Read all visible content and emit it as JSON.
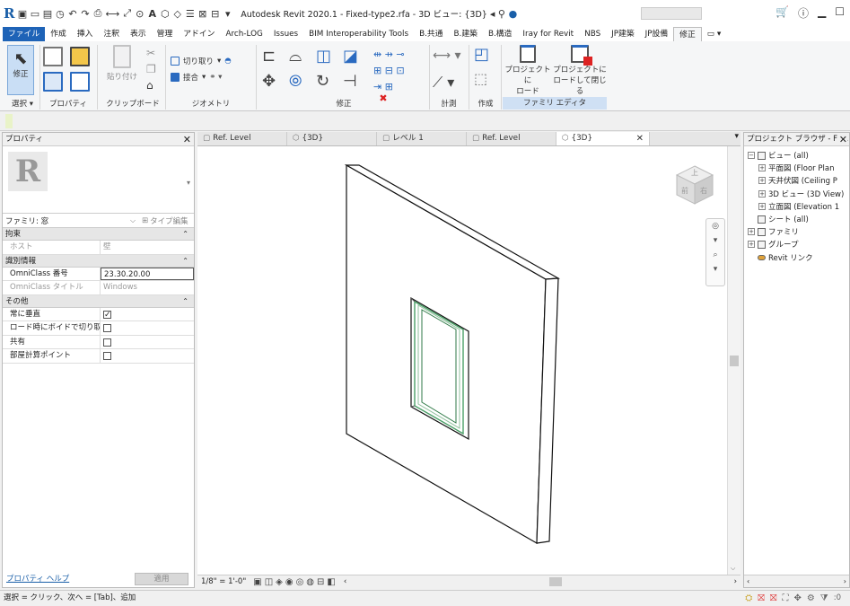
{
  "titlebar": {
    "title": "Autodesk Revit 2020.1 - Fixed-type2.rfa - 3D ビュー: {3D}",
    "quick_access": [
      "open",
      "save",
      "sync",
      "undo",
      "redo",
      "print",
      "measure",
      "text",
      "3d",
      "settings"
    ],
    "window_controls": [
      "minimize",
      "maximize"
    ]
  },
  "tabs": [
    "ファイル",
    "作成",
    "挿入",
    "注釈",
    "表示",
    "管理",
    "アドイン",
    "Arch-LOG",
    "Issues",
    "BIM Interoperability Tools",
    "B.共通",
    "B.建築",
    "B.構造",
    "Iray for Revit",
    "NBS",
    "JP建築",
    "JP設備",
    "修正"
  ],
  "active_tab": "修正",
  "ribbon": {
    "select_label": "修正",
    "select_panel": "選択 ▾",
    "properties_panel": "プロパティ",
    "clipboard_panel": "クリップボード",
    "paste_label": "貼り付け",
    "geometry_panel": "ジオメトリ",
    "cut_label": "切り取り",
    "join_label": "接合",
    "modify_panel": "修正",
    "measure_panel": "計測",
    "create_panel": "作成",
    "family_editor_panel": "ファミリ エディタ",
    "load_project_label": "プロジェクトに\nロード",
    "load_close_label": "プロジェクトに\nロードして閉じる"
  },
  "properties": {
    "title": "プロパティ",
    "family_label": "ファミリ: 窓",
    "edit_type": "タイプ編集",
    "groups": [
      {
        "name": "拘束",
        "rows": [
          {
            "k": "ホスト",
            "v": "壁",
            "gray": true
          }
        ]
      },
      {
        "name": "識別情報",
        "rows": [
          {
            "k": "OmniClass 番号",
            "v": "23.30.20.00"
          },
          {
            "k": "OmniClass タイトル",
            "v": "Windows",
            "gray": true
          }
        ]
      },
      {
        "name": "その他",
        "rows": [
          {
            "k": "常に垂直",
            "cb": true
          },
          {
            "k": "ロード時にボイドで切り取り",
            "cb": false
          },
          {
            "k": "共有",
            "cb": false
          },
          {
            "k": "部屋計算ポイント",
            "cb": false
          }
        ]
      }
    ],
    "help_link": "プロパティ ヘルプ",
    "apply": "適用"
  },
  "view_tabs": [
    {
      "label": "Ref. Level",
      "icon": "plan-icon"
    },
    {
      "label": "{3D}",
      "icon": "3d-icon"
    },
    {
      "label": "レベル 1",
      "icon": "plan-icon"
    },
    {
      "label": "Ref. Level",
      "icon": "plan-icon"
    },
    {
      "label": "{3D}",
      "icon": "3d-icon",
      "active": true
    }
  ],
  "viewcube": {
    "top": "上",
    "front": "前",
    "right": "右"
  },
  "viewbar": {
    "scale": "1/8\" = 1'-0\""
  },
  "browser": {
    "title": "プロジェクト ブラウザ - Fix...",
    "nodes": [
      {
        "label": "ビュー (all)",
        "level": 0,
        "toggle": "−"
      },
      {
        "label": "平面図 (Floor Plan",
        "level": 1,
        "toggle": "+"
      },
      {
        "label": "天井伏図 (Ceiling P",
        "level": 1,
        "toggle": "+"
      },
      {
        "label": "3D ビュー (3D View)",
        "level": 1,
        "toggle": "+"
      },
      {
        "label": "立面図 (Elevation 1",
        "level": 1,
        "toggle": "+"
      },
      {
        "label": "シート (all)",
        "level": 0,
        "toggle": ""
      },
      {
        "label": "ファミリ",
        "level": 0,
        "toggle": "+"
      },
      {
        "label": "グループ",
        "level": 0,
        "toggle": "+"
      },
      {
        "label": "Revit リンク",
        "level": 0,
        "toggle": ""
      }
    ]
  },
  "status": {
    "text": "選択 = クリック、次へ = [Tab]、追加",
    "filter_count": ":0"
  },
  "colors": {
    "file_tab": "#1e63b7",
    "accent": "#1a5fa8"
  }
}
